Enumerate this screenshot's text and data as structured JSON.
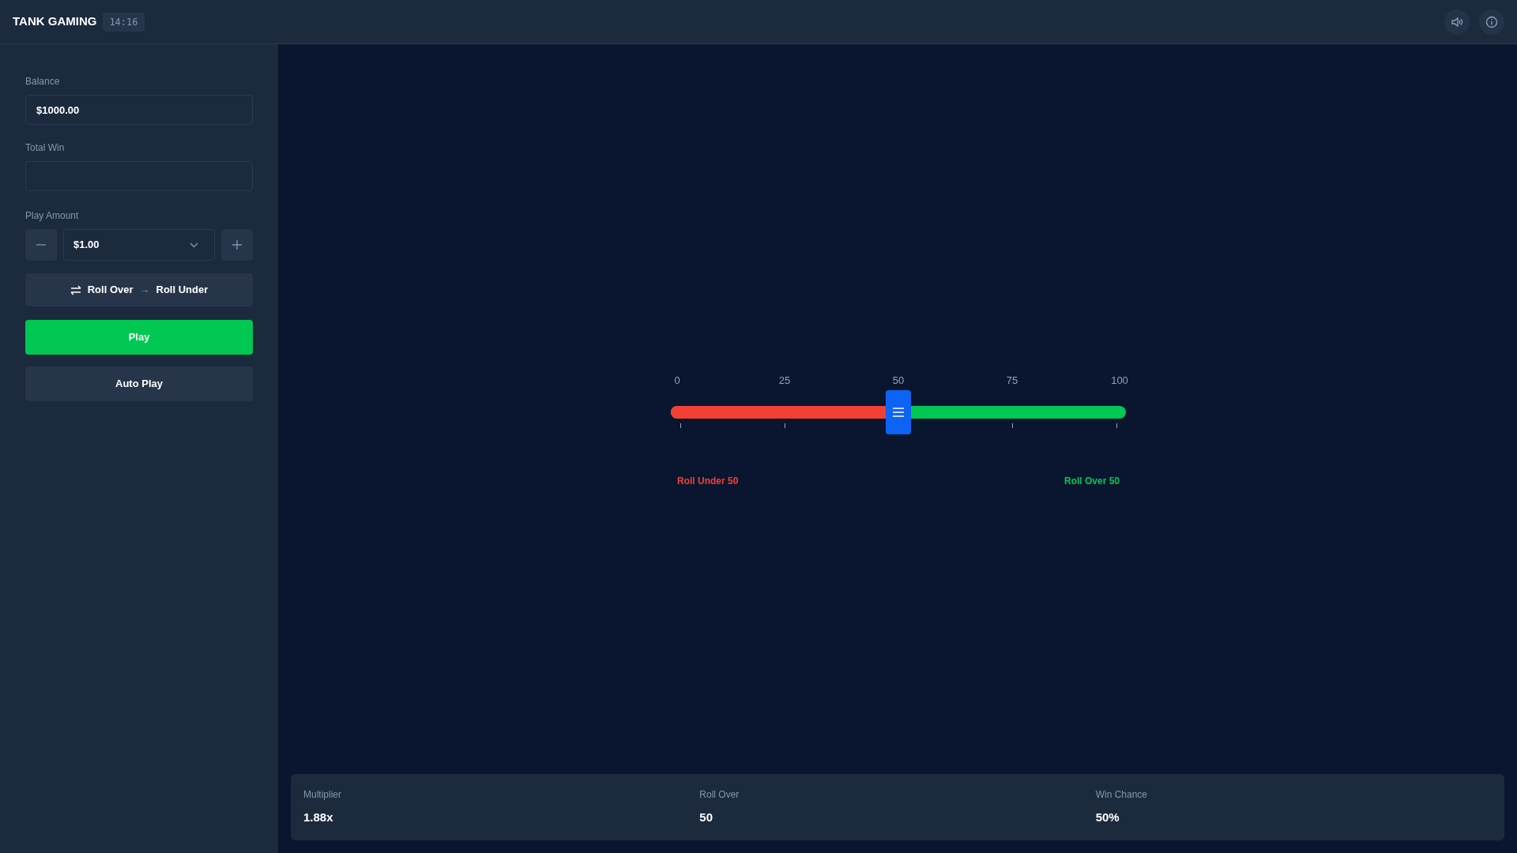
{
  "header": {
    "title": "TANK GAMING",
    "time": "14:16"
  },
  "sidebar": {
    "balance": {
      "label": "Balance",
      "value": "$1000.00"
    },
    "total_win": {
      "label": "Total Win"
    },
    "play_amount": {
      "label": "Play Amount",
      "value": "$1.00"
    },
    "mode_toggle": {
      "from": "Roll Over",
      "arrow": "→",
      "to": "Roll Under"
    },
    "buttons": [
      {
        "label": "Play",
        "kind": "primary"
      },
      {
        "label": "Auto Play",
        "kind": "secondary"
      }
    ]
  },
  "slider": {
    "scale": [
      "0",
      "25",
      "50",
      "75",
      "100"
    ],
    "level": 0.5,
    "under_label": "Roll Under 50",
    "over_label": "Roll Over 50"
  },
  "stats": [
    {
      "label": "Multiplier",
      "value": "1.88x"
    },
    {
      "label": "Roll Over",
      "value": "50"
    },
    {
      "label": "Win Chance",
      "value": "50%"
    }
  ]
}
